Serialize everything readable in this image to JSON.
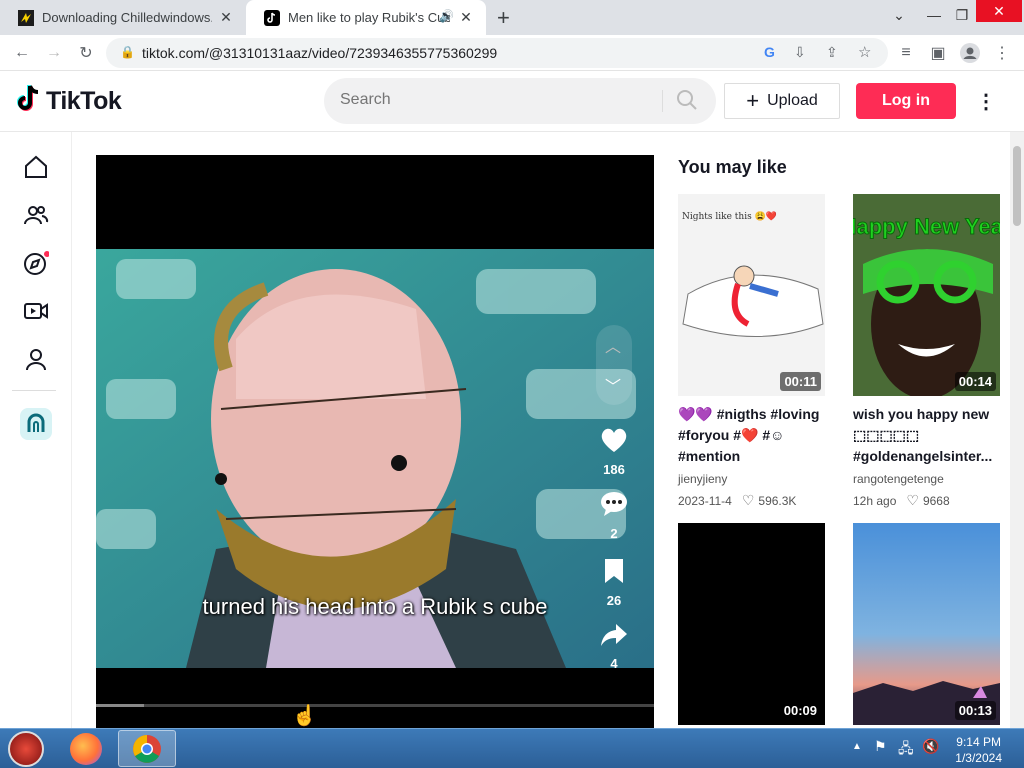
{
  "browser": {
    "tabs": [
      {
        "label": "Downloading Chilledwindows.exe",
        "active": false
      },
      {
        "label": "Men like to play Rubik's Cube",
        "active": true
      }
    ],
    "url": "tiktok.com/@31310131aaz/video/7239346355775360299"
  },
  "header": {
    "logo_text": "TikTok",
    "search_placeholder": "Search",
    "upload_label": "Upload",
    "login_label": "Log in"
  },
  "video": {
    "caption": "turned his head into a Rubik s cube",
    "likes": "186",
    "comments": "2",
    "saves": "26",
    "shares": "4"
  },
  "recommendations": {
    "heading": "You may like",
    "cards": [
      {
        "title": "💜💜 #nigths #loving #foryou #❤️ #☺ #mention",
        "author": "jienyjieny",
        "date": "2023-11-4",
        "likes": "596.3K",
        "duration": "00:11",
        "thumb_text": "Nights like this 😩❤️"
      },
      {
        "title": "wish you happy new ⬚⬚⬚⬚⬚ #goldenangelsinter...",
        "author": "rangotengetenge",
        "date": "12h ago",
        "likes": "9668",
        "duration": "00:14",
        "thumb_text": "Happy New Year"
      },
      {
        "duration": "00:09"
      },
      {
        "duration": "00:13"
      }
    ]
  },
  "taskbar": {
    "time": "9:14 PM",
    "date": "1/3/2024"
  },
  "colors": {
    "brand_red": "#FE2C55",
    "tabstrip": "#DEE1E6",
    "taskbar": "#2c5f97"
  }
}
